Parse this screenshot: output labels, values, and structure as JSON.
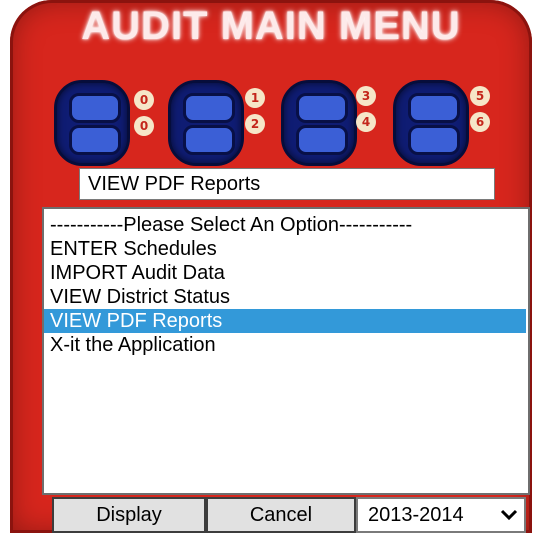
{
  "title": "AUDIT MAIN MENU",
  "switches": [
    {
      "top_label": "0",
      "bottom_label": "0"
    },
    {
      "top_label": "1",
      "bottom_label": "2"
    },
    {
      "top_label": "3",
      "bottom_label": "4"
    },
    {
      "top_label": "5",
      "bottom_label": "6"
    }
  ],
  "selected_option_text": "VIEW PDF Reports",
  "list": {
    "items": [
      "-----------Please Select An Option-----------",
      "ENTER Schedules",
      "IMPORT Audit Data",
      "VIEW District Status",
      "VIEW PDF Reports",
      "X-it the Application"
    ],
    "selected_index": 4
  },
  "buttons": {
    "display_label": "Display",
    "cancel_label": "Cancel"
  },
  "year_select": {
    "value": "2013-2014",
    "icon": "chevron-down-icon"
  },
  "colors": {
    "device_red": "#d7261d",
    "switch_blue": "#3b5fd6",
    "selection_blue": "#3399d9"
  }
}
